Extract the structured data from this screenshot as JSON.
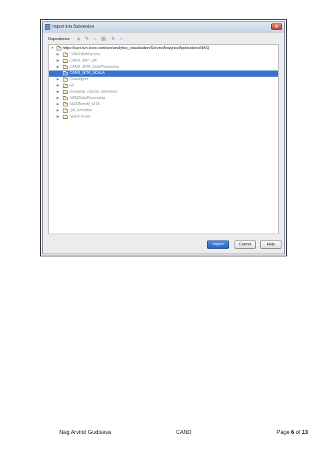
{
  "dialog": {
    "title": "Import into Subversion",
    "close_label": "x",
    "toolbar": {
      "label": "Repositories:",
      "icons": [
        "add-icon",
        "edit-icon",
        "remove-icon",
        "browse-icon",
        "refresh-icon",
        "collapse-icon"
      ]
    },
    "tree": {
      "root": {
        "expanded": true,
        "label": "https://savi-svn.cisco.com/svn/analytics_visualization/ServiceAnalytics/Applications/NAIQ"
      },
      "items": [
        {
          "label": "CANDWebService",
          "selected": false
        },
        {
          "label": "CAND_BAT_QA",
          "selected": false
        },
        {
          "label": "CAND_NITA_DataProcessing",
          "selected": false
        },
        {
          "label": "CAND_NITA_SCALA",
          "selected": true
        },
        {
          "label": "CaseMgmt",
          "selected": false
        },
        {
          "label": "EF",
          "selected": false
        },
        {
          "label": "Grouping_Upload_download",
          "selected": false
        },
        {
          "label": "NAIQDataProcessing",
          "selected": false
        },
        {
          "label": "NDARetrofit_NITA",
          "selected": false
        },
        {
          "label": "QA_Activities",
          "selected": false
        },
        {
          "label": "Spark-Scala",
          "selected": false
        }
      ]
    },
    "buttons": {
      "import": "Import",
      "cancel": "Cancel",
      "help": "Help"
    },
    "colors": {
      "selection": "#3a74c9",
      "import_button": "#2a66c0",
      "close_button": "#c3412d"
    }
  },
  "footer": {
    "author": "Nag Arvind Gudiseva",
    "doc": "CAND",
    "page_prefix": "Page ",
    "page_current": "6",
    "page_of": " of ",
    "page_total": "13"
  }
}
